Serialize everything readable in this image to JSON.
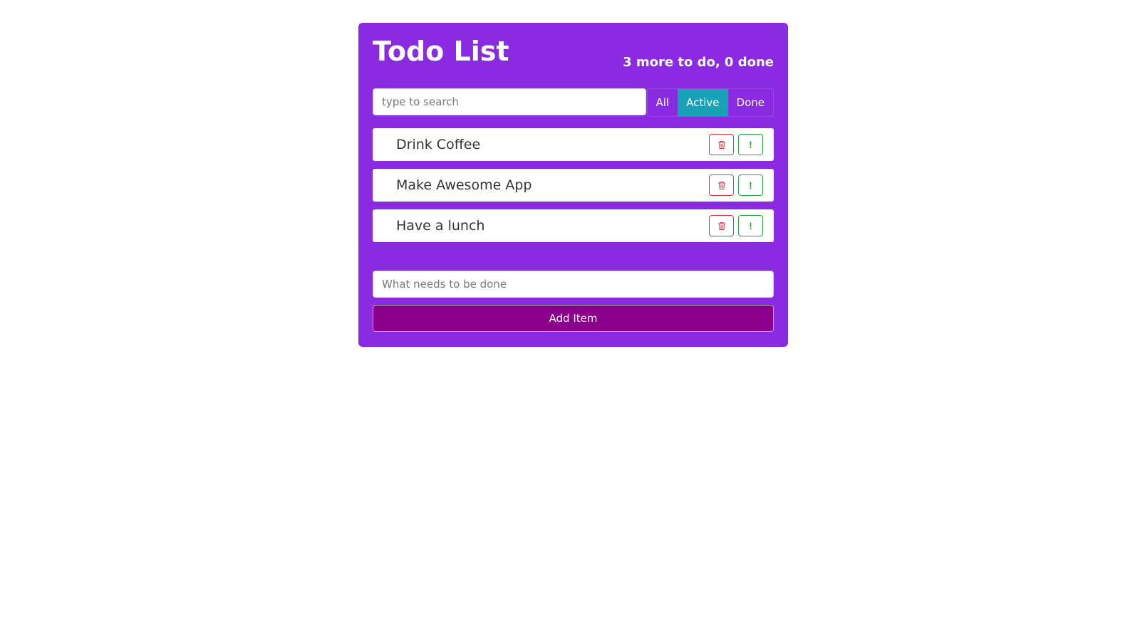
{
  "header": {
    "title": "Todo List",
    "counter": "3 more to do, 0 done"
  },
  "search": {
    "placeholder": "type to search",
    "value": ""
  },
  "filters": [
    {
      "label": "All",
      "active": false
    },
    {
      "label": "Active",
      "active": true
    },
    {
      "label": "Done",
      "active": false
    }
  ],
  "items": [
    {
      "label": "Drink Coffee",
      "important_icon": "!",
      "delete_icon": "trash-icon"
    },
    {
      "label": "Make Awesome App",
      "important_icon": "!",
      "delete_icon": "trash-icon"
    },
    {
      "label": "Have a lunch",
      "important_icon": "!",
      "delete_icon": "trash-icon"
    }
  ],
  "add_form": {
    "placeholder": "What needs to be done",
    "value": "",
    "button_label": "Add Item"
  },
  "colors": {
    "panel": "#8a2be2",
    "active_filter": "#17a2b8",
    "add_button": "#8b008b",
    "delete": "#dc3545",
    "important": "#28a745"
  }
}
